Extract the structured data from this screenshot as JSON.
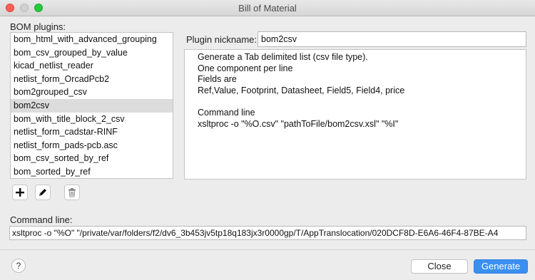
{
  "window": {
    "title": "Bill of Material"
  },
  "bom_plugins": {
    "label": "BOM plugins:",
    "items": [
      "bom_html_with_advanced_grouping",
      "bom_csv_grouped_by_value",
      "kicad_netlist_reader",
      "netlist_form_OrcadPcb2",
      "bom2grouped_csv",
      "bom2csv",
      "bom_with_title_block_2_csv",
      "netlist_form_cadstar-RINF",
      "netlist_form_pads-pcb.asc",
      "bom_csv_sorted_by_ref",
      "bom_sorted_by_ref"
    ],
    "selected_index": 5
  },
  "plugin_nickname": {
    "label": "Plugin nickname:",
    "value": "bom2csv"
  },
  "description": {
    "lines": [
      "Generate a Tab delimited list (csv file type).",
      "One component per line",
      "Fields are",
      "Ref,Value, Footprint, Datasheet, Field5, Field4, price",
      "",
      "Command line",
      "xsltproc -o \"%O.csv\" \"pathToFile/bom2csv.xsl\" \"%I\""
    ]
  },
  "toolbar": {
    "add_icon": "plus-icon",
    "edit_icon": "pencil-icon",
    "remove_icon": "trash-icon"
  },
  "command_line": {
    "label": "Command line:",
    "value": "xsltproc -o \"%O\" \"/private/var/folders/f2/dv6_3b453jv5tp18q183jx3r0000gp/T/AppTranslocation/020DCF8D-E6A6-46F4-87BE-A4"
  },
  "footer": {
    "help_label": "?",
    "close_label": "Close",
    "generate_label": "Generate"
  },
  "colors": {
    "accent": "#3b8ff0",
    "selection": "#dcdcdc"
  }
}
